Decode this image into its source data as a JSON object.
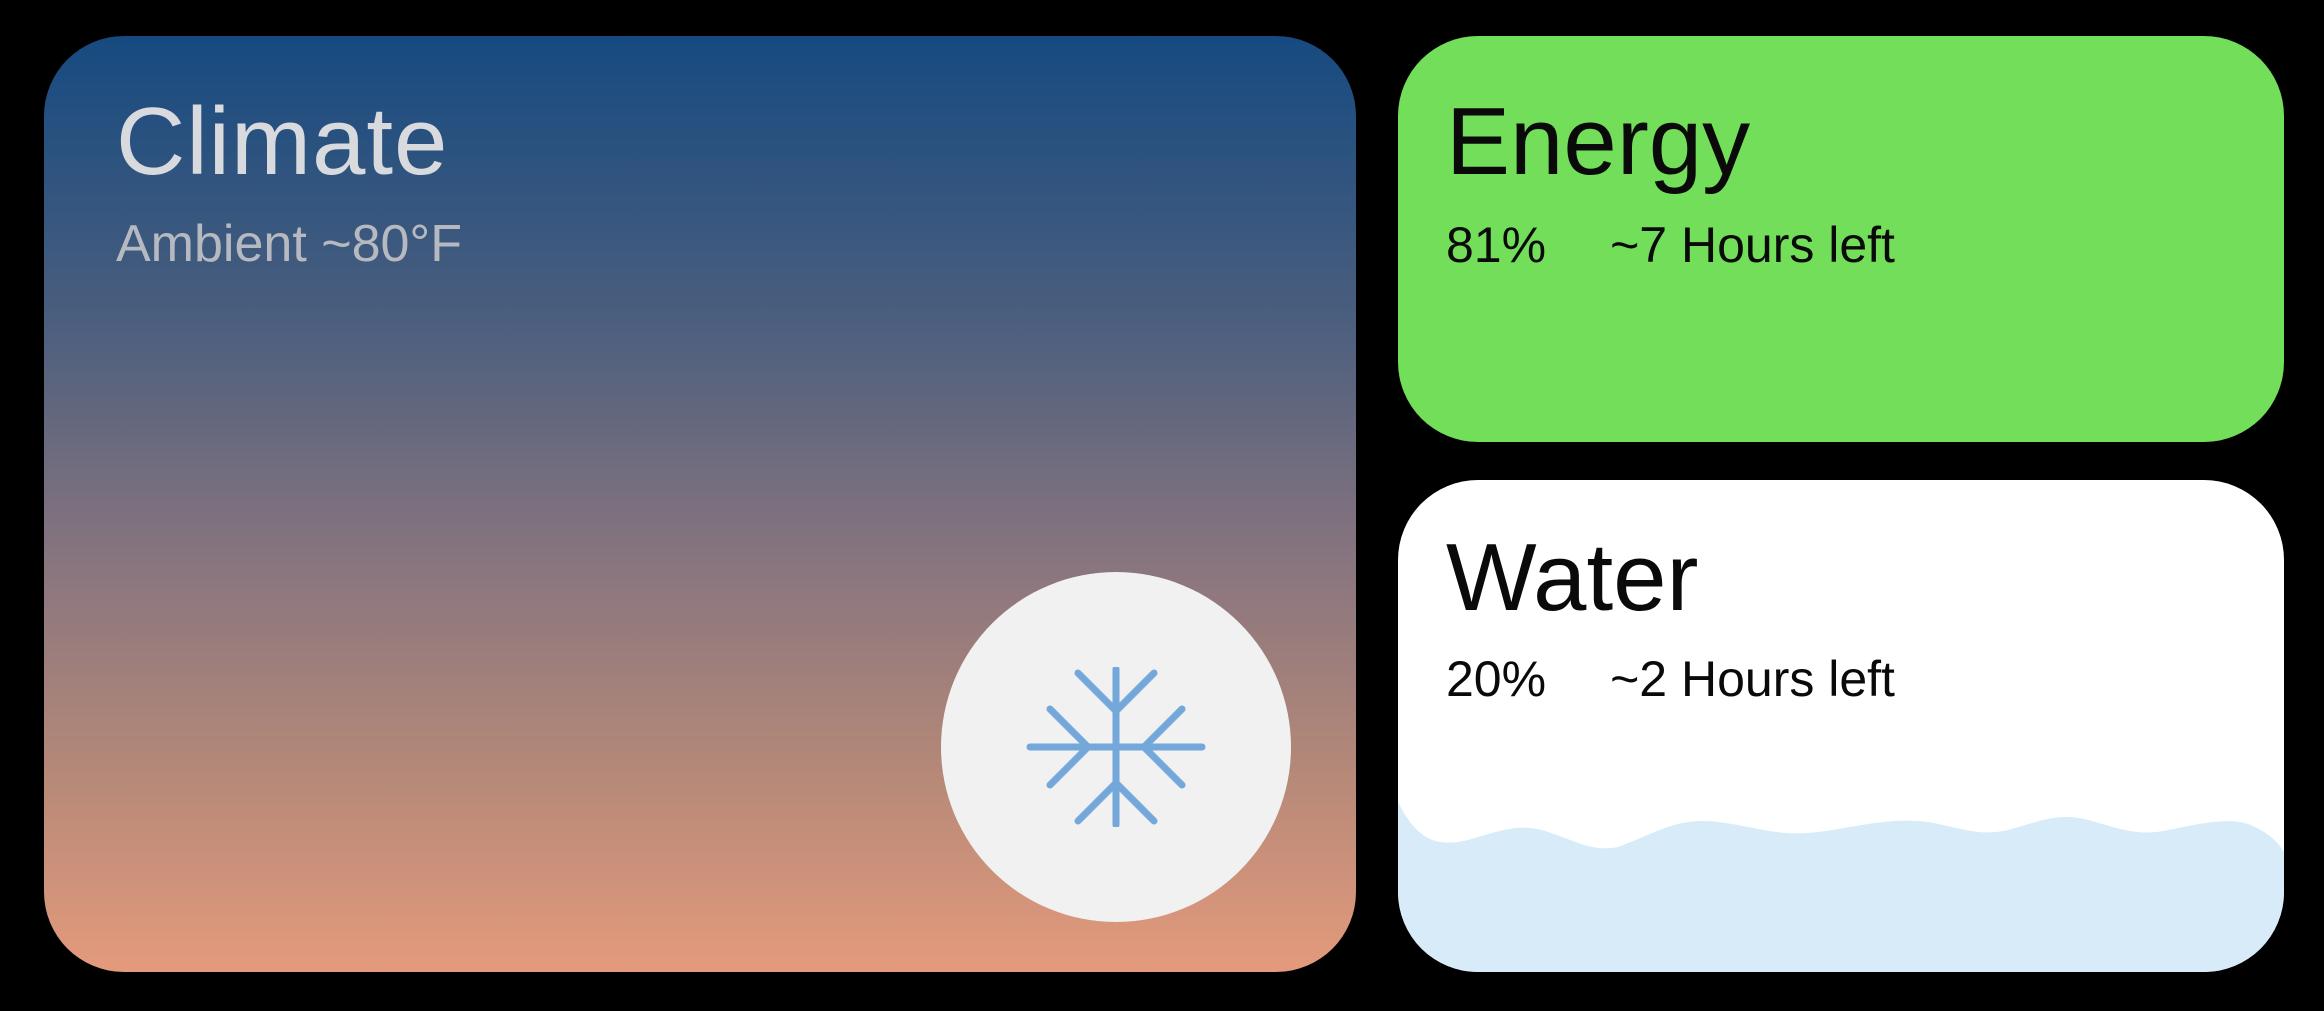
{
  "climate": {
    "title": "Climate",
    "ambient": "Ambient ~80°F",
    "mode_icon": "snowflake-icon",
    "gradient_top": "#164a80",
    "gradient_bottom": "#e49a7c",
    "icon_color": "#74a8da"
  },
  "energy": {
    "title": "Energy",
    "percent": "81%",
    "time_left": "~7 Hours left",
    "color": "#72de5a"
  },
  "water": {
    "title": "Water",
    "percent": "20%",
    "time_left": "~2 Hours left",
    "level": 0.2,
    "wave_color": "#d7ebf8"
  }
}
